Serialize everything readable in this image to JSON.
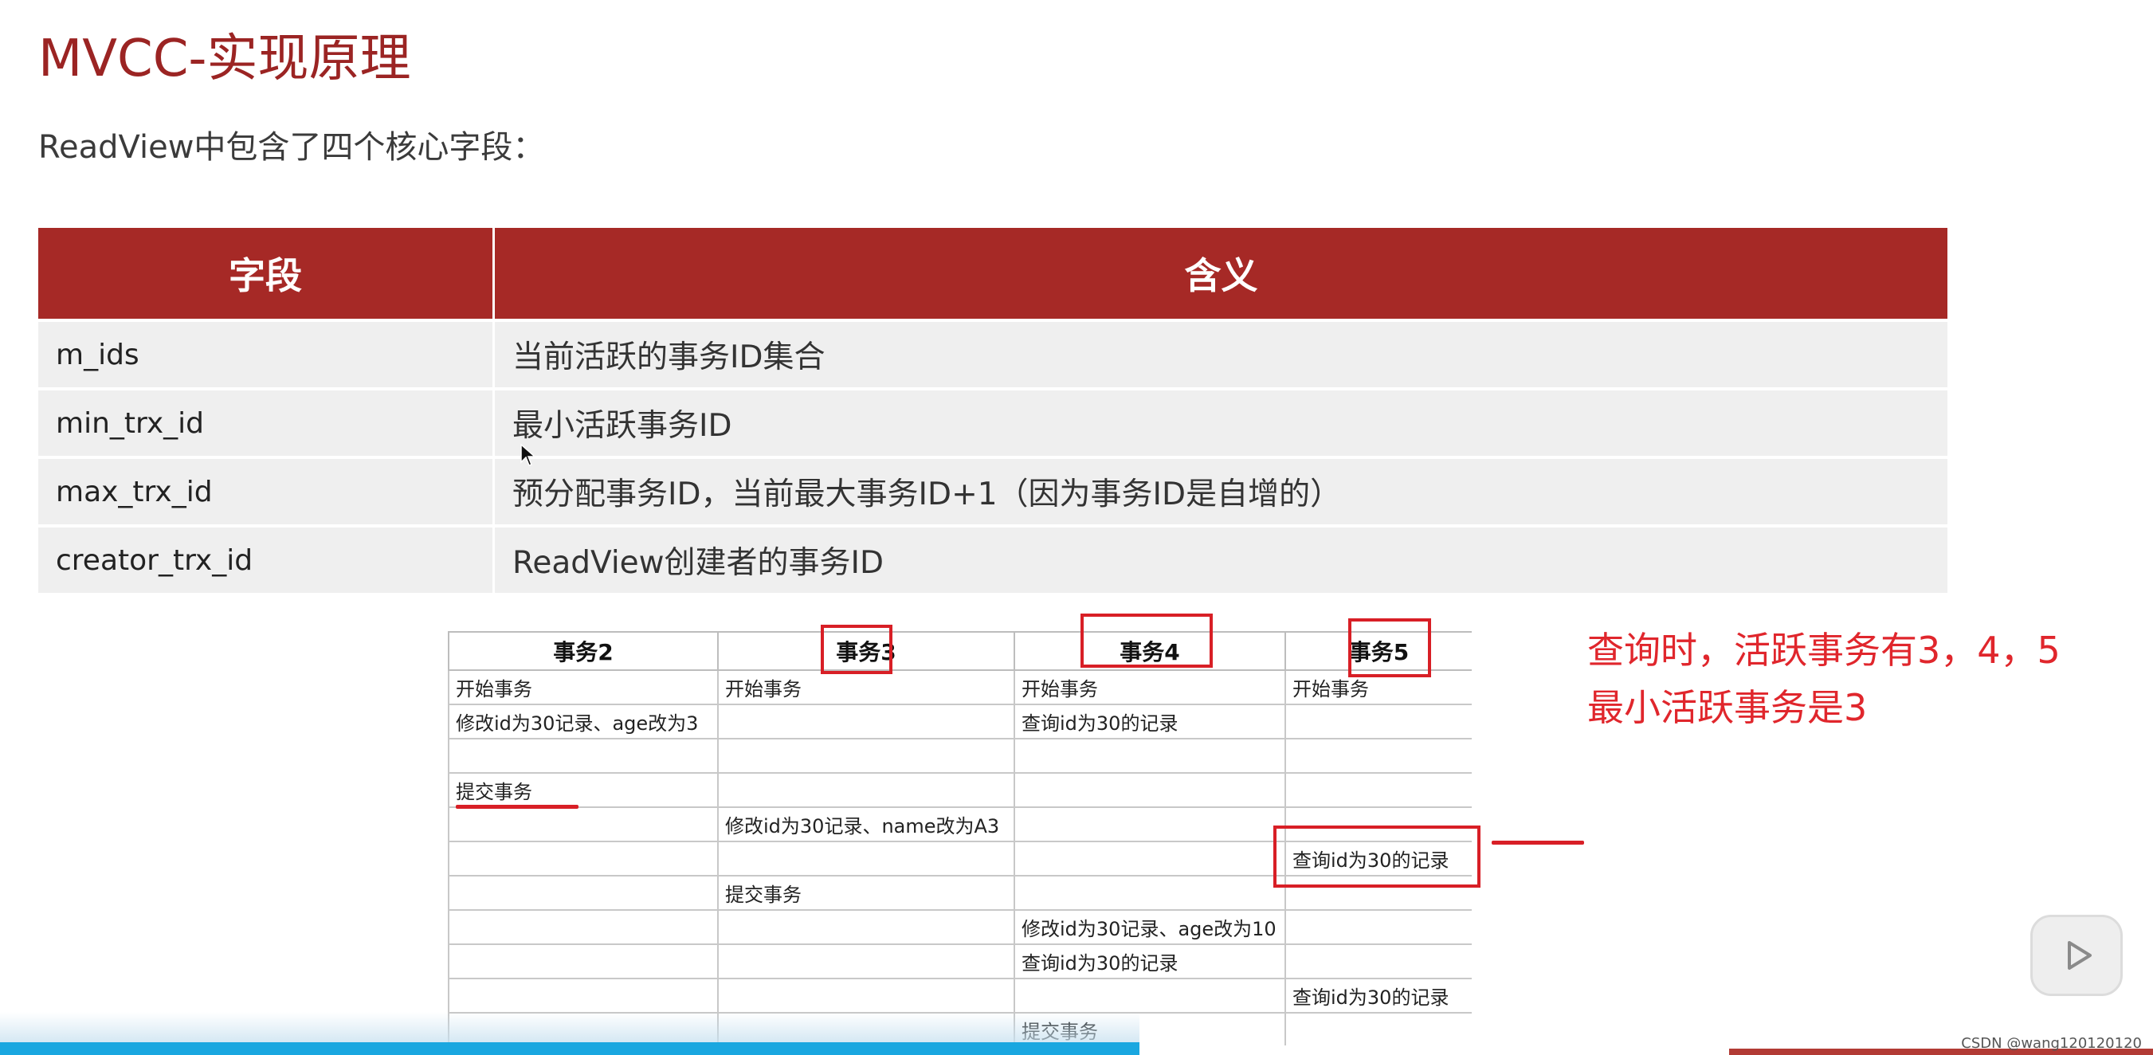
{
  "slide": {
    "title": "MVCC-实现原理",
    "subtitle": "ReadView中包含了四个核心字段："
  },
  "field_table": {
    "headers": [
      "字段",
      "含义"
    ],
    "rows": [
      {
        "field": "m_ids",
        "meaning": "当前活跃的事务ID集合"
      },
      {
        "field": "min_trx_id",
        "meaning": "最小活跃事务ID"
      },
      {
        "field": "max_trx_id",
        "meaning": "预分配事务ID，当前最大事务ID+1（因为事务ID是自增的）"
      },
      {
        "field": "creator_trx_id",
        "meaning": "ReadView创建者的事务ID"
      }
    ]
  },
  "txn_table": {
    "headers": [
      "事务2",
      "事务3",
      "事务4",
      "事务5"
    ],
    "rows": [
      [
        "开始事务",
        "开始事务",
        "开始事务",
        "开始事务"
      ],
      [
        "修改id为30记录、age改为3",
        "",
        "查询id为30的记录",
        ""
      ],
      [
        "",
        "",
        "",
        ""
      ],
      [
        "提交事务",
        "",
        "",
        ""
      ],
      [
        "",
        "修改id为30记录、name改为A3",
        "",
        ""
      ],
      [
        "",
        "",
        "",
        "查询id为30的记录"
      ],
      [
        "",
        "提交事务",
        "",
        ""
      ],
      [
        "",
        "",
        "修改id为30记录、age改为10",
        ""
      ],
      [
        "",
        "",
        "查询id为30的记录",
        ""
      ],
      [
        "",
        "",
        "",
        "查询id为30的记录"
      ],
      [
        "",
        "",
        "提交事务",
        ""
      ]
    ]
  },
  "annotation": {
    "line1": "查询时，活跃事务有3，4，5",
    "line2": "最小活跃事务是3"
  },
  "colors": {
    "title": "#9b2423",
    "header_bg": "#a62926",
    "highlight": "#d81f26"
  },
  "watermark": "CSDN @wang120120120",
  "icons": [
    "cursor-icon",
    "play-icon"
  ]
}
